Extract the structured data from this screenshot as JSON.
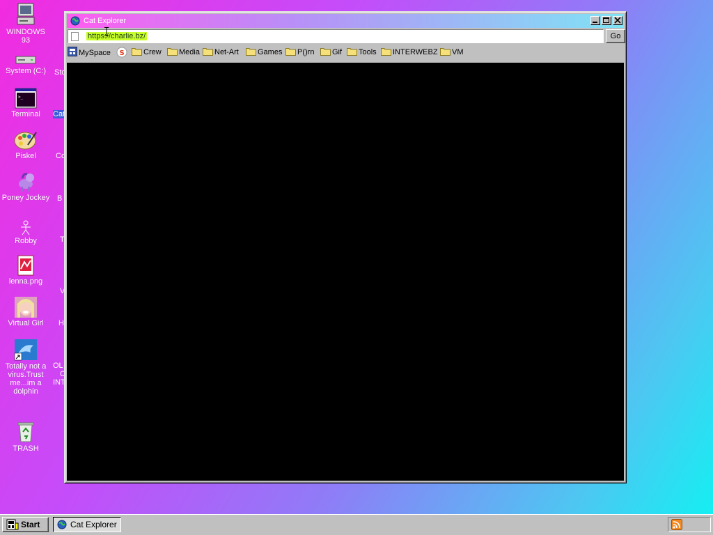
{
  "desktop": {
    "icons": [
      {
        "label": "WINDOWS 93",
        "icon": "computer-icon"
      },
      {
        "label": "System (C:)",
        "icon": "drive-icon"
      },
      {
        "label": "Terminal",
        "icon": "terminal-icon"
      },
      {
        "label": "Piskel",
        "icon": "palette-icon"
      },
      {
        "label": "Poney Jockey",
        "icon": "pony-icon"
      },
      {
        "label": "Robby",
        "icon": "stickman-icon"
      },
      {
        "label": "lenna.png",
        "icon": "image-file-icon"
      },
      {
        "label": "Virtual Girl",
        "icon": "face-icon"
      },
      {
        "label": "Totally not a virus.Trust me...im a dolphin",
        "icon": "dolphin-icon"
      },
      {
        "label": "TRASH",
        "icon": "recycle-bin-icon"
      }
    ],
    "peek_labels": [
      "Sto",
      "Cat",
      "Co",
      "B",
      "T",
      "V",
      "H",
      "OL",
      "C",
      "INT"
    ]
  },
  "window": {
    "title": "Cat Explorer",
    "title_icon": "globe-icon",
    "address": {
      "url": "https://charlie.bz/"
    },
    "go_label": "Go",
    "bookmarks": [
      {
        "label": "MySpace",
        "icon": "myspace-icon"
      },
      {
        "label": "",
        "icon": "s-logo-icon"
      },
      {
        "label": "Crew",
        "icon": "folder-icon"
      },
      {
        "label": "Media",
        "icon": "folder-icon"
      },
      {
        "label": "Net-Art",
        "icon": "folder-icon"
      },
      {
        "label": "Games",
        "icon": "folder-icon"
      },
      {
        "label": "P()rn",
        "icon": "folder-icon"
      },
      {
        "label": "Gif",
        "icon": "folder-icon"
      },
      {
        "label": "Tools",
        "icon": "folder-icon"
      },
      {
        "label": "INTERWEBZ",
        "icon": "folder-icon"
      },
      {
        "label": "VM",
        "icon": "folder-icon"
      }
    ]
  },
  "taskbar": {
    "start_label": "Start",
    "tasks": [
      {
        "label": "Cat Explorer",
        "icon": "globe-icon"
      }
    ],
    "tray_icon": "rss-icon"
  },
  "colors": {
    "desktop_gradient": [
      "#f22be0",
      "#10f2f2"
    ],
    "url_highlight": "#c8ff2b",
    "content_bg": "#000000"
  }
}
